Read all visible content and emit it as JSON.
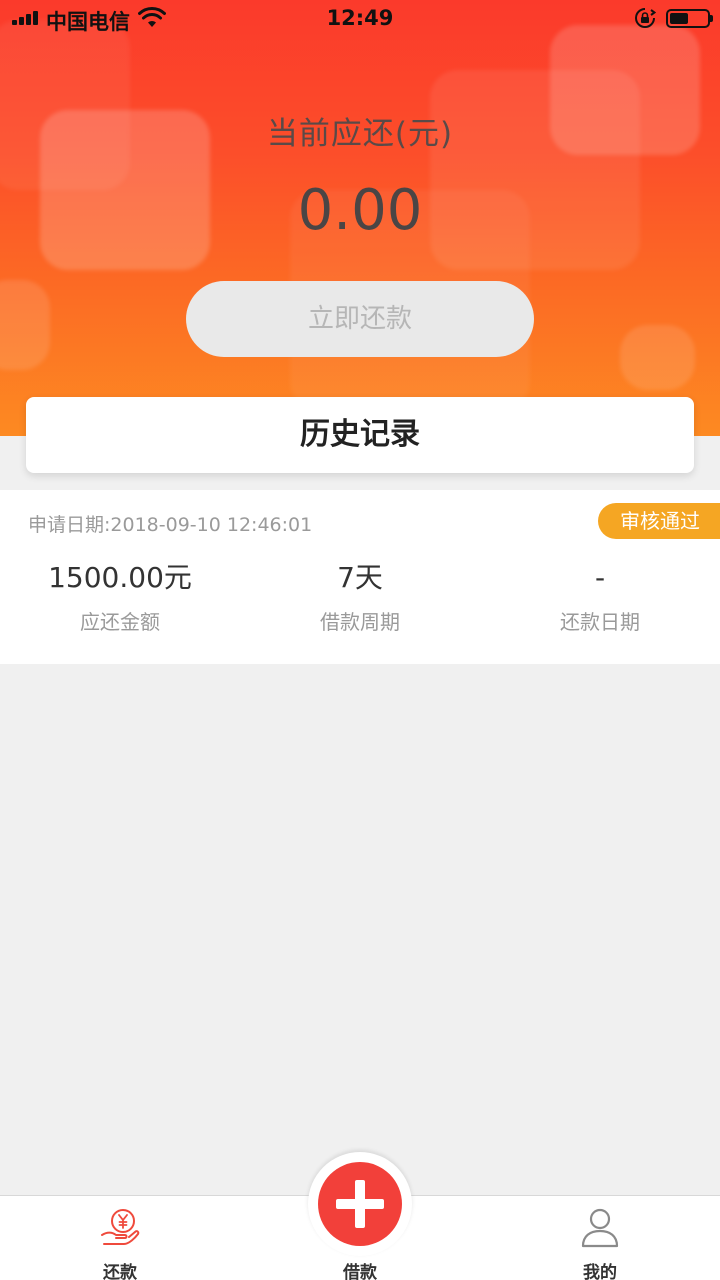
{
  "status_bar": {
    "carrier": "中国电信",
    "time": "12:49",
    "battery_level": 0.5
  },
  "header": {
    "label": "当前应还(元)",
    "amount": "0.00",
    "repay_button": "立即还款"
  },
  "history": {
    "title": "历史记录",
    "records": [
      {
        "apply_date": "申请日期:2018-09-10 12:46:01",
        "status": "审核通过",
        "amount": "1500.00元",
        "amount_label": "应还金额",
        "period": "7天",
        "period_label": "借款周期",
        "repay_date": "-",
        "repay_date_label": "还款日期"
      }
    ]
  },
  "tabbar": {
    "tabs": [
      {
        "label": "还款",
        "icon": "repay-hand-yen-icon"
      },
      {
        "label": "借款",
        "icon": "plus-icon"
      },
      {
        "label": "我的",
        "icon": "user-icon"
      }
    ]
  },
  "colors": {
    "header_top": "#fb3a2b",
    "header_bottom": "#fd8a22",
    "badge": "#f5a623",
    "fab": "#f2403a"
  }
}
